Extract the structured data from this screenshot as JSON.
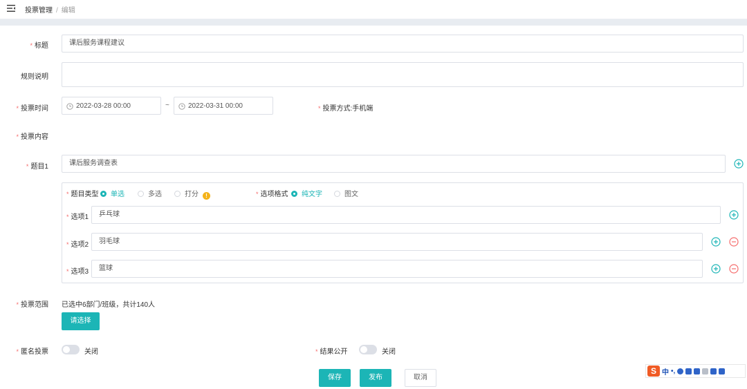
{
  "breadcrumb": {
    "parent": "投票管理",
    "separator": "/",
    "current": "编辑"
  },
  "form": {
    "title_label": "标题",
    "title_value": "课后服务课程建议",
    "rules_label": "规则说明",
    "rules_value": "",
    "time_label": "投票时间",
    "start_time": "2022-03-28 00:00",
    "time_separator": "~",
    "end_time": "2022-03-31 00:00",
    "method_label": "投票方式:",
    "method_value": "手机端",
    "content_label": "投票内容",
    "question1_label": "题目1",
    "question1_value": "课后服务调查表",
    "qtype_label": "题目类型",
    "qtype_options": [
      "单选",
      "多选",
      "打分"
    ],
    "qtype_selected": "单选",
    "option_format_label": "选项格式",
    "option_format_options": [
      "纯文字",
      "图文"
    ],
    "option_format_selected": "纯文字",
    "options": [
      {
        "label": "选项1",
        "value": "乒乓球"
      },
      {
        "label": "选项2",
        "value": "羽毛球"
      },
      {
        "label": "选项3",
        "value": "篮球"
      }
    ],
    "scope_label": "投票范围",
    "scope_summary": "已选中6部门/班级，共计140人",
    "scope_button": "请选择",
    "anonymous_label": "匿名投票",
    "anonymous_state": "关闭",
    "result_public_label": "结果公开",
    "result_public_state": "关闭"
  },
  "actions": {
    "save": "保存",
    "publish": "发布",
    "cancel": "取消"
  },
  "ime": {
    "mode": "中"
  },
  "colors": {
    "accent": "#1cb5b6",
    "required": "#f56c6c",
    "remove": "#f56c6c",
    "warning": "#f4b31a"
  }
}
